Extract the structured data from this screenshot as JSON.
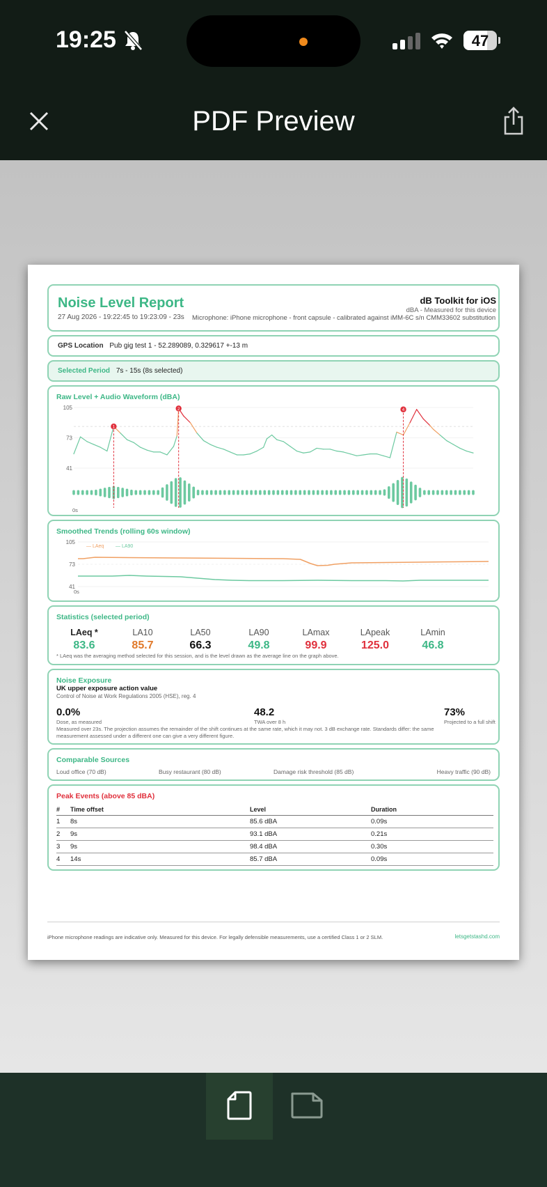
{
  "status": {
    "time": "19:25",
    "battery": "47"
  },
  "nav": {
    "title": "PDF Preview"
  },
  "report": {
    "title": "Noise Level Report",
    "date_range": "27 Aug 2026  -  19:22:45 to 19:23:09  -  23s",
    "app_name": "dB Toolkit for iOS",
    "unit_line": "dBA  -  Measured for this device",
    "microphone": "Microphone: iPhone microphone - front capsule - calibrated against iMM-6C s/n CMM33602 substitution",
    "gps": {
      "label": "GPS Location",
      "value": "Pub gig test 1  -  52.289089, 0.329617  +-13 m"
    },
    "period": {
      "label": "Selected Period",
      "value": "7s - 15s  (8s selected)"
    },
    "raw_chart_title": "Raw Level + Audio Waveform  (dBA)",
    "trend_chart_title": "Smoothed Trends  (rolling 60s window)",
    "statistics": {
      "title": "Statistics  (selected period)",
      "items": [
        {
          "name": "LAeq *",
          "value": "83.6",
          "color": "#3db786"
        },
        {
          "name": "LA10",
          "value": "85.7",
          "color": "#e0792a"
        },
        {
          "name": "LA50",
          "value": "66.3",
          "color": "#111111"
        },
        {
          "name": "LA90",
          "value": "49.8",
          "color": "#3db786"
        },
        {
          "name": "LAmax",
          "value": "99.9",
          "color": "#e0303c"
        },
        {
          "name": "LApeak",
          "value": "125.0",
          "color": "#e0303c"
        },
        {
          "name": "LAmin",
          "value": "46.8",
          "color": "#3db786"
        }
      ],
      "note": "* LAeq was the averaging method selected for this session, and is the level drawn as the average line on the graph above."
    },
    "exposure": {
      "title": "Noise Exposure",
      "heading": "UK upper exposure action value",
      "regulation": "Control of Noise at Work Regulations 2005 (HSE), reg. 4",
      "dose_value": "0.0%",
      "dose_label": "Dose, as measured",
      "twa_value": "48.2",
      "twa_label": "TWA over 8 h",
      "proj_value": "73%",
      "proj_label": "Projected to a full shift",
      "note_1": "Measured over 23s. The projection assumes the remainder of the shift continues at the same rate, which it may not. 3 dB exchange rate. Standards differ: the same",
      "note_2": "measurement assessed under a different one can give a very different figure."
    },
    "comparable": {
      "title": "Comparable Sources",
      "items": [
        "Loud office (70 dB)",
        "Busy restaurant (80 dB)",
        "Damage risk threshold (85 dB)",
        "Heavy traffic (90 dB)"
      ]
    },
    "peaks": {
      "title": "Peak Events  (above 85 dBA)",
      "headers": [
        "#",
        "Time offset",
        "Level",
        "Duration"
      ],
      "rows": [
        [
          "1",
          "8s",
          "85.6 dBA",
          "0.09s"
        ],
        [
          "2",
          "9s",
          "93.1 dBA",
          "0.21s"
        ],
        [
          "3",
          "9s",
          "98.4 dBA",
          "0.30s"
        ],
        [
          "4",
          "14s",
          "85.7 dBA",
          "0.09s"
        ]
      ]
    },
    "footer_note": "iPhone microphone readings are indicative only. Measured for this device. For legally defensible measurements, use a certified Class 1 or 2 SLM.",
    "footer_link": "letsgetstashd.com"
  },
  "chart_data": [
    {
      "type": "line",
      "title": "Raw Level + Audio Waveform  (dBA)",
      "ylim": [
        0,
        105
      ],
      "y_ticks": [
        "105",
        "73",
        "41"
      ],
      "x_tick": "0s",
      "reference_lines": [
        105,
        85,
        73,
        41
      ],
      "series": [
        {
          "x": [
            0,
            0.4,
            0.8,
            1.2,
            1.6,
            2.0,
            2.4,
            2.8,
            3.2,
            3.6,
            4.0,
            4.4,
            4.8,
            5.2,
            5.6,
            6.0,
            6.2,
            6.3,
            6.6,
            7.0,
            7.4,
            7.8,
            8.2,
            8.6,
            9.0,
            9.4,
            9.8,
            10.2,
            10.6,
            11.0,
            11.4,
            11.6,
            11.9,
            12.2,
            12.6,
            13.0,
            13.4,
            13.8,
            14.2,
            14.6,
            15.0,
            15.4,
            15.8,
            16.2,
            16.6,
            17.0,
            17.4,
            17.8,
            18.2,
            18.6,
            19.0,
            19.4,
            19.8,
            20.2,
            20.6,
            21.0,
            21.4,
            21.6,
            22.0,
            22.4,
            22.8,
            23.2,
            23.6,
            24.0
          ],
          "values": [
            56,
            74,
            69,
            66,
            63,
            59,
            85,
            78,
            71,
            68,
            63,
            60,
            58,
            58,
            55,
            64,
            75,
            104,
            96,
            89,
            78,
            70,
            66,
            63,
            61,
            58,
            55,
            55,
            56,
            59,
            63,
            72,
            76,
            71,
            69,
            64,
            59,
            57,
            58,
            62,
            61,
            61,
            59,
            58,
            56,
            54,
            55,
            56,
            56,
            54,
            52,
            79,
            76,
            89,
            103,
            93,
            86,
            82,
            76,
            70,
            66,
            62,
            59,
            57
          ],
          "peaks": [
            {
              "x": 2.4,
              "value": 85,
              "label": "1"
            },
            {
              "x": 6.3,
              "value": 104,
              "label": "2"
            },
            {
              "x": 19.8,
              "value": 103,
              "label": "4"
            }
          ]
        }
      ]
    },
    {
      "type": "line",
      "title": "Smoothed Trends  (rolling 60s window)",
      "ylim": [
        41,
        105
      ],
      "y_ticks": [
        "105",
        "73",
        "41"
      ],
      "x_tick": "0s",
      "series": [
        {
          "name": "LAeq",
          "color": "#f0a063",
          "x": [
            0,
            0.3,
            1,
            3,
            6,
            9,
            12,
            13,
            13.6,
            14,
            14.6,
            15,
            16,
            18,
            20,
            22,
            24
          ],
          "values": [
            81,
            81,
            83,
            82.5,
            82,
            81.5,
            81,
            80,
            74,
            71,
            71.5,
            73,
            75,
            75.5,
            76,
            76.5,
            77
          ]
        },
        {
          "name": "LA90",
          "color": "#6cc9a0",
          "x": [
            0,
            2,
            3,
            4,
            6,
            7,
            8,
            9,
            10,
            12,
            14,
            16,
            18,
            19,
            20,
            22,
            24
          ],
          "values": [
            56,
            56,
            57,
            56,
            55,
            53,
            51,
            50,
            49.5,
            49.5,
            50,
            49.5,
            49.5,
            49,
            50,
            50,
            50
          ]
        }
      ]
    }
  ]
}
